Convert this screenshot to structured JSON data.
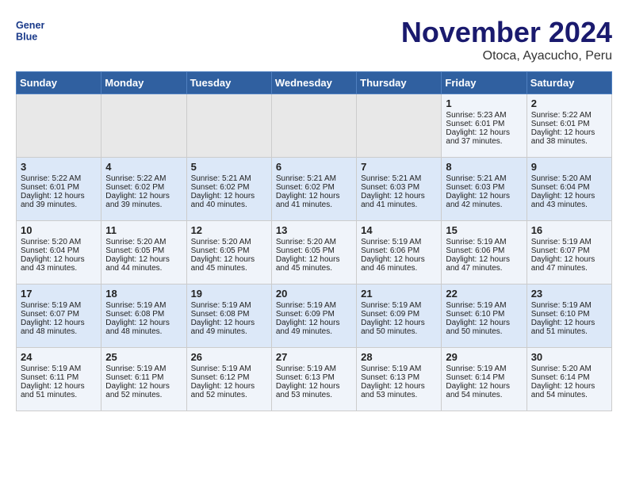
{
  "logo": {
    "line1": "General",
    "line2": "Blue"
  },
  "title": "November 2024",
  "subtitle": "Otoca, Ayacucho, Peru",
  "days_of_week": [
    "Sunday",
    "Monday",
    "Tuesday",
    "Wednesday",
    "Thursday",
    "Friday",
    "Saturday"
  ],
  "weeks": [
    [
      {
        "day": "",
        "info": ""
      },
      {
        "day": "",
        "info": ""
      },
      {
        "day": "",
        "info": ""
      },
      {
        "day": "",
        "info": ""
      },
      {
        "day": "",
        "info": ""
      },
      {
        "day": "1",
        "info": "Sunrise: 5:23 AM\nSunset: 6:01 PM\nDaylight: 12 hours\nand 37 minutes."
      },
      {
        "day": "2",
        "info": "Sunrise: 5:22 AM\nSunset: 6:01 PM\nDaylight: 12 hours\nand 38 minutes."
      }
    ],
    [
      {
        "day": "3",
        "info": "Sunrise: 5:22 AM\nSunset: 6:01 PM\nDaylight: 12 hours\nand 39 minutes."
      },
      {
        "day": "4",
        "info": "Sunrise: 5:22 AM\nSunset: 6:02 PM\nDaylight: 12 hours\nand 39 minutes."
      },
      {
        "day": "5",
        "info": "Sunrise: 5:21 AM\nSunset: 6:02 PM\nDaylight: 12 hours\nand 40 minutes."
      },
      {
        "day": "6",
        "info": "Sunrise: 5:21 AM\nSunset: 6:02 PM\nDaylight: 12 hours\nand 41 minutes."
      },
      {
        "day": "7",
        "info": "Sunrise: 5:21 AM\nSunset: 6:03 PM\nDaylight: 12 hours\nand 41 minutes."
      },
      {
        "day": "8",
        "info": "Sunrise: 5:21 AM\nSunset: 6:03 PM\nDaylight: 12 hours\nand 42 minutes."
      },
      {
        "day": "9",
        "info": "Sunrise: 5:20 AM\nSunset: 6:04 PM\nDaylight: 12 hours\nand 43 minutes."
      }
    ],
    [
      {
        "day": "10",
        "info": "Sunrise: 5:20 AM\nSunset: 6:04 PM\nDaylight: 12 hours\nand 43 minutes."
      },
      {
        "day": "11",
        "info": "Sunrise: 5:20 AM\nSunset: 6:05 PM\nDaylight: 12 hours\nand 44 minutes."
      },
      {
        "day": "12",
        "info": "Sunrise: 5:20 AM\nSunset: 6:05 PM\nDaylight: 12 hours\nand 45 minutes."
      },
      {
        "day": "13",
        "info": "Sunrise: 5:20 AM\nSunset: 6:05 PM\nDaylight: 12 hours\nand 45 minutes."
      },
      {
        "day": "14",
        "info": "Sunrise: 5:19 AM\nSunset: 6:06 PM\nDaylight: 12 hours\nand 46 minutes."
      },
      {
        "day": "15",
        "info": "Sunrise: 5:19 AM\nSunset: 6:06 PM\nDaylight: 12 hours\nand 47 minutes."
      },
      {
        "day": "16",
        "info": "Sunrise: 5:19 AM\nSunset: 6:07 PM\nDaylight: 12 hours\nand 47 minutes."
      }
    ],
    [
      {
        "day": "17",
        "info": "Sunrise: 5:19 AM\nSunset: 6:07 PM\nDaylight: 12 hours\nand 48 minutes."
      },
      {
        "day": "18",
        "info": "Sunrise: 5:19 AM\nSunset: 6:08 PM\nDaylight: 12 hours\nand 48 minutes."
      },
      {
        "day": "19",
        "info": "Sunrise: 5:19 AM\nSunset: 6:08 PM\nDaylight: 12 hours\nand 49 minutes."
      },
      {
        "day": "20",
        "info": "Sunrise: 5:19 AM\nSunset: 6:09 PM\nDaylight: 12 hours\nand 49 minutes."
      },
      {
        "day": "21",
        "info": "Sunrise: 5:19 AM\nSunset: 6:09 PM\nDaylight: 12 hours\nand 50 minutes."
      },
      {
        "day": "22",
        "info": "Sunrise: 5:19 AM\nSunset: 6:10 PM\nDaylight: 12 hours\nand 50 minutes."
      },
      {
        "day": "23",
        "info": "Sunrise: 5:19 AM\nSunset: 6:10 PM\nDaylight: 12 hours\nand 51 minutes."
      }
    ],
    [
      {
        "day": "24",
        "info": "Sunrise: 5:19 AM\nSunset: 6:11 PM\nDaylight: 12 hours\nand 51 minutes."
      },
      {
        "day": "25",
        "info": "Sunrise: 5:19 AM\nSunset: 6:11 PM\nDaylight: 12 hours\nand 52 minutes."
      },
      {
        "day": "26",
        "info": "Sunrise: 5:19 AM\nSunset: 6:12 PM\nDaylight: 12 hours\nand 52 minutes."
      },
      {
        "day": "27",
        "info": "Sunrise: 5:19 AM\nSunset: 6:13 PM\nDaylight: 12 hours\nand 53 minutes."
      },
      {
        "day": "28",
        "info": "Sunrise: 5:19 AM\nSunset: 6:13 PM\nDaylight: 12 hours\nand 53 minutes."
      },
      {
        "day": "29",
        "info": "Sunrise: 5:19 AM\nSunset: 6:14 PM\nDaylight: 12 hours\nand 54 minutes."
      },
      {
        "day": "30",
        "info": "Sunrise: 5:20 AM\nSunset: 6:14 PM\nDaylight: 12 hours\nand 54 minutes."
      }
    ]
  ]
}
